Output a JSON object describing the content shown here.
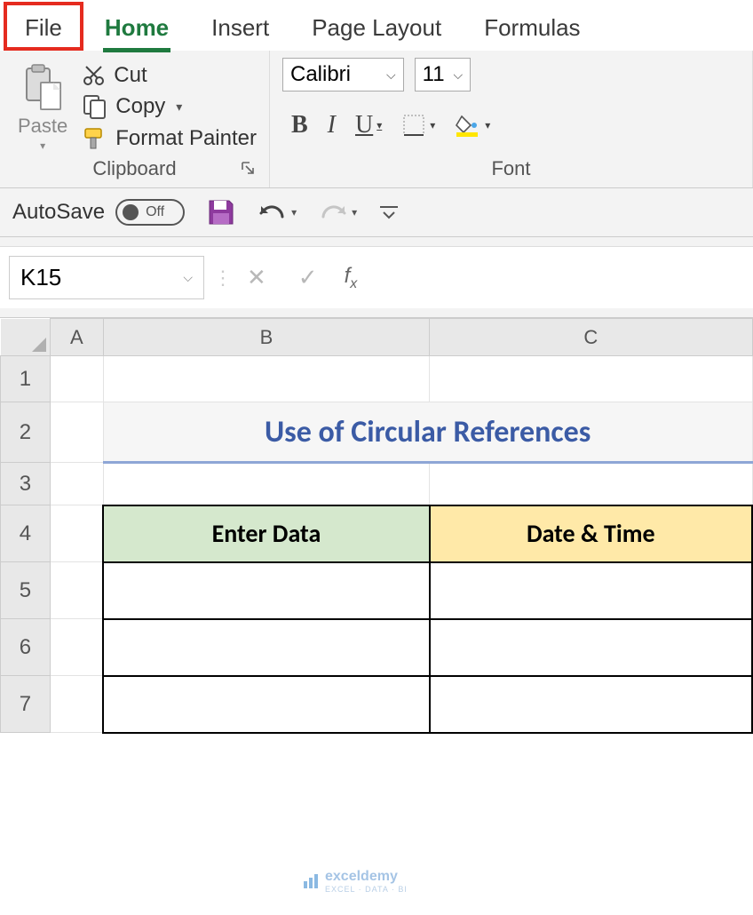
{
  "ribbon": {
    "tabs": {
      "file": "File",
      "home": "Home",
      "insert": "Insert",
      "page_layout": "Page Layout",
      "formulas": "Formulas"
    },
    "active_tab": "Home"
  },
  "clipboard": {
    "paste": "Paste",
    "cut": "Cut",
    "copy": "Copy",
    "format_painter": "Format Painter",
    "group_label": "Clipboard"
  },
  "font": {
    "name": "Calibri",
    "size": "11",
    "group_label": "Font"
  },
  "qat": {
    "autosave_label": "AutoSave",
    "autosave_state": "Off"
  },
  "formula_bar": {
    "name_box": "K15",
    "formula": ""
  },
  "grid": {
    "columns": [
      "A",
      "B",
      "C"
    ],
    "rows": [
      "1",
      "2",
      "3",
      "4",
      "5",
      "6",
      "7"
    ],
    "title": "Use of Circular References",
    "headers": {
      "b": "Enter Data",
      "c": "Date & Time"
    },
    "data": {
      "B5": "",
      "C5": "",
      "B6": "",
      "C6": "",
      "B7": "",
      "C7": ""
    }
  },
  "watermark": {
    "brand": "exceldemy",
    "tagline": "EXCEL · DATA · BI"
  },
  "annotation": {
    "highlighted_tab": "File"
  }
}
